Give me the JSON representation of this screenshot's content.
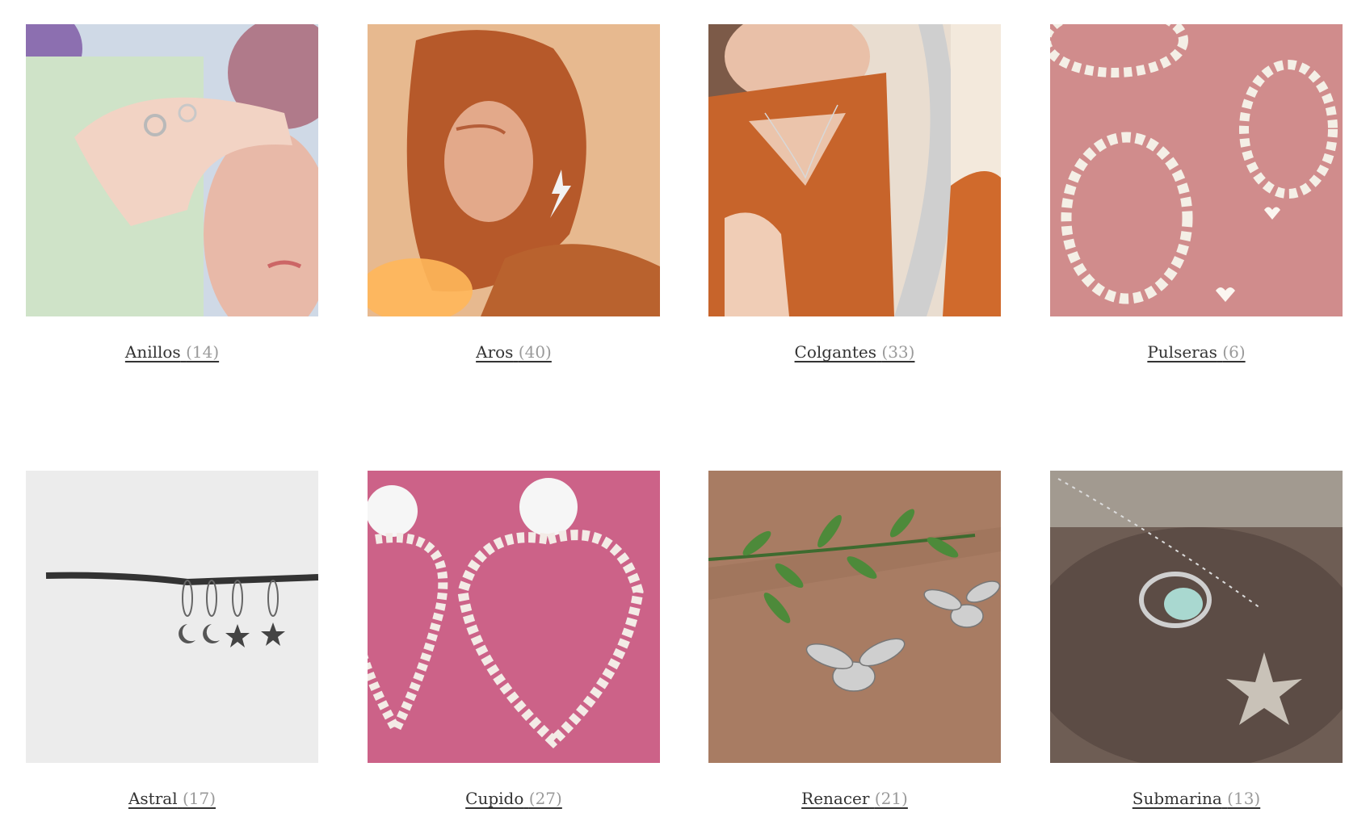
{
  "categories": [
    {
      "name": "Anillos",
      "count": "(14)",
      "image": "hand-with-rings-photo"
    },
    {
      "name": "Aros",
      "count": "(40)",
      "image": "woman-lightning-earring-photo"
    },
    {
      "name": "Colgantes",
      "count": "(33)",
      "image": "woman-mirror-necklace-photo"
    },
    {
      "name": "Pulseras",
      "count": "(6)",
      "image": "pearl-bracelets-photo"
    },
    {
      "name": "Astral",
      "count": "(17)",
      "image": "moon-star-earrings-branch-photo"
    },
    {
      "name": "Cupido",
      "count": "(27)",
      "image": "pearl-heart-earrings-photo"
    },
    {
      "name": "Renacer",
      "count": "(21)",
      "image": "bee-earrings-wood-photo"
    },
    {
      "name": "Submarina",
      "count": "(13)",
      "image": "starfish-necklace-ring-photo"
    }
  ]
}
